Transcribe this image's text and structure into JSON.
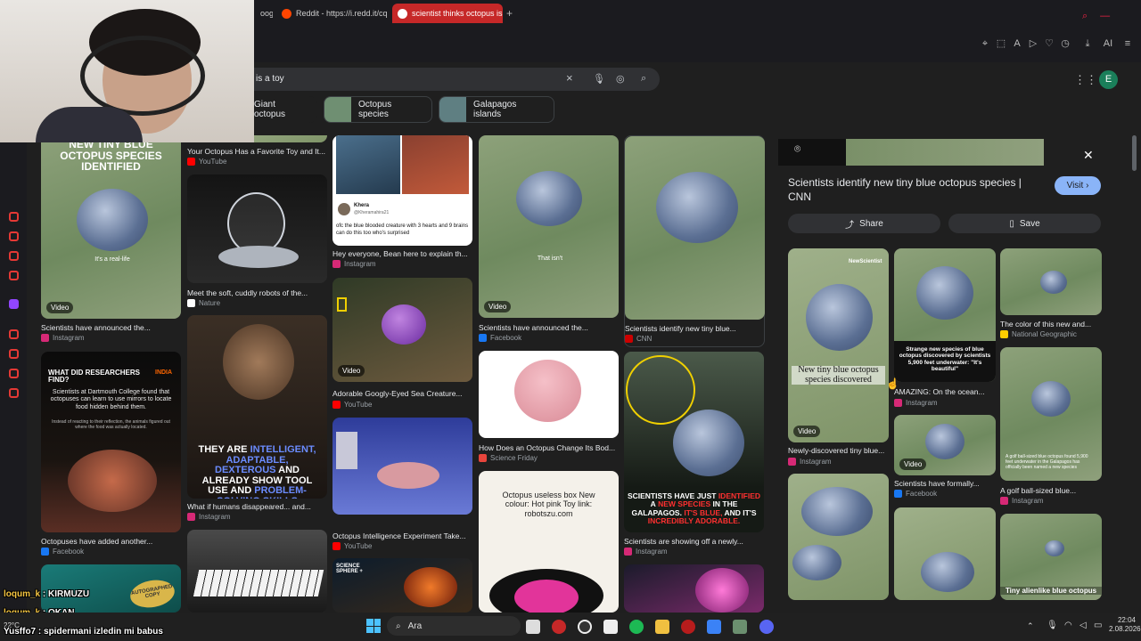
{
  "browser": {
    "tabs": [
      {
        "label": "oog",
        "active": false
      },
      {
        "label": "Reddit - https://i.redd.it/cq",
        "active": false
      },
      {
        "label": "scientist thinks octopus is a",
        "active": true
      }
    ],
    "new_tab": "+",
    "account_label": "AI"
  },
  "search": {
    "query": "is a toy",
    "clear_icon": "×",
    "avatar_letter": "E"
  },
  "chips": [
    {
      "label": "Giant octopus"
    },
    {
      "label": "Octopus species"
    },
    {
      "label": "Galapagos islands"
    }
  ],
  "results": {
    "col1": [
      {
        "overlay": "NEW TINY BLUE OCTOPUS SPECIES IDENTIFIED",
        "sub_overlay": "It's a real-life",
        "badge": "Video",
        "caption": "Scientists have announced the...",
        "source": "Instagram"
      },
      {
        "overlay": "WHAT DID RESEARCHERS FIND?",
        "body": "Scientists at Dartmouth College found that octopuses can learn to use mirrors to locate food hidden behind them.",
        "small": "Instead of reacting to their reflection, the animals figured out where the food was actually located.",
        "brand": "INDIA",
        "caption": "Octopuses have added another...",
        "source": "Facebook"
      },
      {
        "overlay": "AUTOGRAPHED COPY",
        "caption": "",
        "source": ""
      }
    ],
    "col2": [
      {
        "caption": "Your Octopus Has a Favorite Toy and It...",
        "source": "YouTube"
      },
      {
        "caption": "Meet the soft, cuddly robots of the...",
        "source": "Nature"
      },
      {
        "overlay_white": "THEY ARE",
        "overlay_blue": "INTELLIGENT, ADAPTABLE, DEXTEROUS",
        "overlay_white2": "AND ALREADY SHOW TOOL USE AND",
        "overlay_blue2": "PROBLEM-SOLVING SKILLS",
        "caption": "What if humans disappeared... and...",
        "source": "Instagram"
      }
    ],
    "col3": [
      {
        "tweet_name": "Khera",
        "tweet_handle": "@Kheramahira21",
        "tweet_text": "ofc the blue blooded creature with 3 hearts and 9 brains can do this too who's surprised",
        "caption": "Hey everyone, Bean here to explain th...",
        "source": "Instagram"
      },
      {
        "badge": "Video",
        "caption": "Adorable Googly-Eyed Sea Creature...",
        "source": "YouTube"
      },
      {
        "caption": "Octopus Intelligence Experiment Take...",
        "source": "YouTube"
      },
      {
        "overlay": "SCIENCE SPHERE +",
        "caption": "",
        "source": ""
      }
    ],
    "col4": [
      {
        "sub_overlay": "That isn't",
        "badge": "Video",
        "caption": "Scientists have announced the...",
        "source": "Facebook"
      },
      {
        "caption": "How Does an Octopus Change Its Bod...",
        "source": "Science Friday"
      },
      {
        "overlay": "Octopus useless box New colour: Hot pink Toy link: robotszu.com",
        "caption": "",
        "source": ""
      }
    ],
    "col5": [
      {
        "caption": "Scientists identify new tiny blue...",
        "source": "CNN"
      },
      {
        "overlay_white": "SCIENTISTS HAVE JUST",
        "overlay_red": "IDENTIFIED",
        "overlay_white_a": "A",
        "overlay_red2": "NEW SPECIES",
        "overlay_white2": "IN THE GALAPAGOS.",
        "overlay_red3": "IT'S BLUE,",
        "overlay_white3": "AND IT'S",
        "overlay_red4": "INCREDIBLY ADORABLE.",
        "caption": "Scientists are showing off a newly...",
        "source": "Instagram"
      }
    ]
  },
  "panel": {
    "title": "Scientists identify new tiny blue octopus species | CNN",
    "visit_label": "Visit",
    "share_label": "Share",
    "save_label": "Save",
    "related": [
      {
        "overlay": "New tiny blue octopus species discovered",
        "brand": "NewScientist",
        "badge": "Video",
        "caption": "Newly-discovered tiny blue...",
        "source": "Instagram"
      },
      {
        "overlay": "Strange new species of blue octopus discovered by scientists 5,900 feet underwater: \"It's beautiful\"",
        "caption": "AMAZING: On the ocean...",
        "source": "Instagram"
      },
      {
        "caption": "The color of this new and...",
        "source": "National Geographic"
      },
      {
        "badge": "Video",
        "caption": "Scientists have formally...",
        "source": "Facebook"
      },
      {
        "overlay": "A golf ball-sized blue octopus found 5,900 feet underwater in the Galapagos has officially been named a new species",
        "caption": "A golf ball-sized blue...",
        "source": "Instagram"
      },
      {
        "caption": "",
        "source": ""
      },
      {
        "caption": "",
        "source": ""
      },
      {
        "overlay": "Tiny alienlike blue octopus",
        "caption": "",
        "source": ""
      }
    ]
  },
  "chat": [
    {
      "user": "loqum_k",
      "text": ": KIRMUZU"
    },
    {
      "user": "loqum_k",
      "text": ": OKAN"
    },
    {
      "user": "Yusffo7",
      "text": ": spidermani izledin mi babus"
    }
  ],
  "taskbar": {
    "search_label": "Ara",
    "weather": "22°C",
    "time": "22:04",
    "date": "2.08.2026"
  },
  "colors": {
    "accent": "#8ab4f8",
    "active_tab": "#c62828",
    "surface": "#1f1f1f",
    "chip_border": "#3c4043"
  },
  "icons": [
    "search-icon",
    "mic-icon",
    "lens-icon",
    "close-icon",
    "apps-grid-icon",
    "share-icon",
    "bookmark-icon",
    "chevron-right-icon",
    "windows-start-icon",
    "spotify-icon",
    "folder-icon",
    "discord-icon",
    "wifi-icon",
    "volume-icon",
    "battery-icon"
  ]
}
